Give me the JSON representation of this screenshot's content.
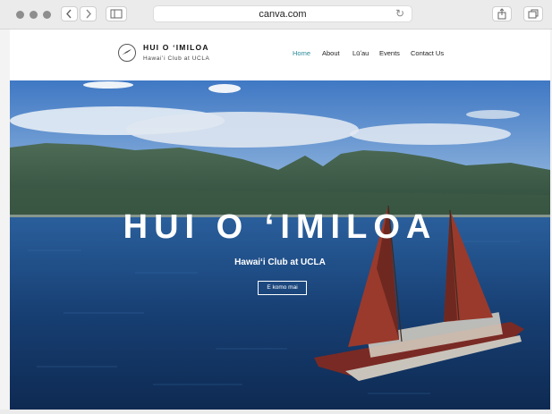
{
  "browser": {
    "url": "canva.com",
    "reload_icon": "↻"
  },
  "site": {
    "logo_title": "HUI O ʻIMILOA",
    "logo_subtitle": "Hawaiʻi Club at UCLA",
    "nav": [
      "Home",
      "About",
      "Lūʻau",
      "Events",
      "Contact Us"
    ]
  },
  "hero": {
    "title": "HUI O ʻIMILOA",
    "subtitle": "Hawaiʻi Club at UCLA",
    "button": "E komo mai"
  },
  "colors": {
    "nav_active": "#2a8a9a",
    "sail": "#9a3a2c"
  }
}
